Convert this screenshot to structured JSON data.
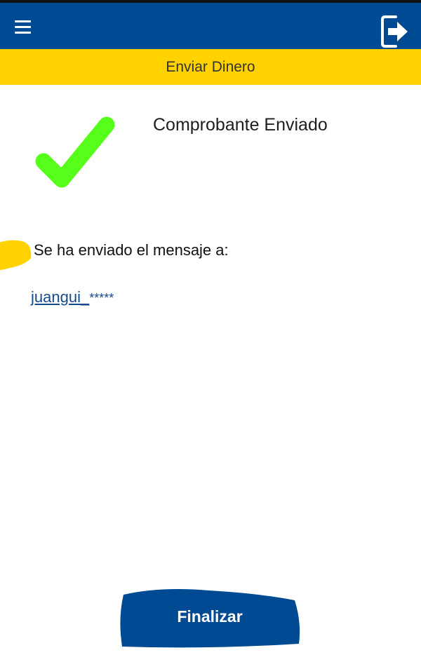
{
  "header": {
    "menu_icon": "hamburger-menu-icon",
    "logout_icon": "logout-icon",
    "background_color": "#004a94"
  },
  "subheader": {
    "title": "Enviar Dinero",
    "background_color": "#ffd200"
  },
  "confirmation": {
    "status_icon": "checkmark-icon",
    "icon_color": "#55ff1a",
    "title": "Comprobante Enviado"
  },
  "message": {
    "label": "Se ha enviado el mensaje a:",
    "recipient_link": "juangui_",
    "recipient_masked": "*****"
  },
  "footer": {
    "finish_label": "Finalizar"
  }
}
